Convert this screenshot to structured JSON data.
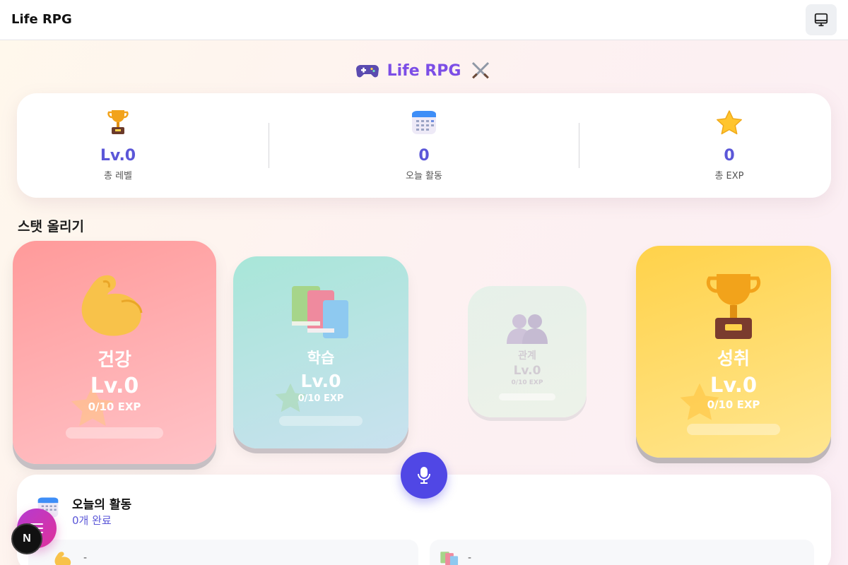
{
  "header": {
    "app_title": "Life RPG",
    "theme_icon": "monitor-icon"
  },
  "page": {
    "title": "Life RPG",
    "title_left_icon": "gamepad-icon",
    "title_right_icon": "crossed-swords-icon"
  },
  "summary": [
    {
      "icon": "trophy-icon",
      "value": "Lv.0",
      "label": "총 레벨"
    },
    {
      "icon": "calendar-icon",
      "value": "0",
      "label": "오늘 활동"
    },
    {
      "icon": "star-icon",
      "value": "0",
      "label": "총 EXP"
    }
  ],
  "section_title": "스탯 올리기",
  "stats": [
    {
      "key": "health",
      "icon": "flexed-biceps-icon",
      "name": "건강",
      "level": "Lv.0",
      "exp": "0/10 EXP",
      "progress": 0
    },
    {
      "key": "study",
      "icon": "books-icon",
      "name": "학습",
      "level": "Lv.0",
      "exp": "0/10 EXP",
      "progress": 0
    },
    {
      "key": "relation",
      "icon": "people-icon",
      "name": "관계",
      "level": "Lv.0",
      "exp": "0/10 EXP",
      "progress": 0
    },
    {
      "key": "achieve",
      "icon": "trophy-icon",
      "name": "성취",
      "level": "Lv.0",
      "exp": "0/10 EXP",
      "progress": 0
    }
  ],
  "mic_button": {
    "icon": "microphone-icon"
  },
  "activity": {
    "icon": "calendar-icon",
    "title": "오늘의 활동",
    "count": "0개 완료",
    "items": [
      {
        "icon": "flexed-biceps-icon",
        "text": "-"
      },
      {
        "icon": "books-icon",
        "text": "-"
      }
    ]
  },
  "menu_fab": {
    "icon": "menu-icon"
  },
  "next_badge": {
    "label": "N"
  },
  "colors": {
    "accent": "#5b57d8",
    "heading": "#7c4ee6",
    "mic": "#5047e5",
    "health": "#ff9a9a",
    "study": "#a8e6d8",
    "relation": "#e1f1e8",
    "achieve": "#ffd24a"
  }
}
